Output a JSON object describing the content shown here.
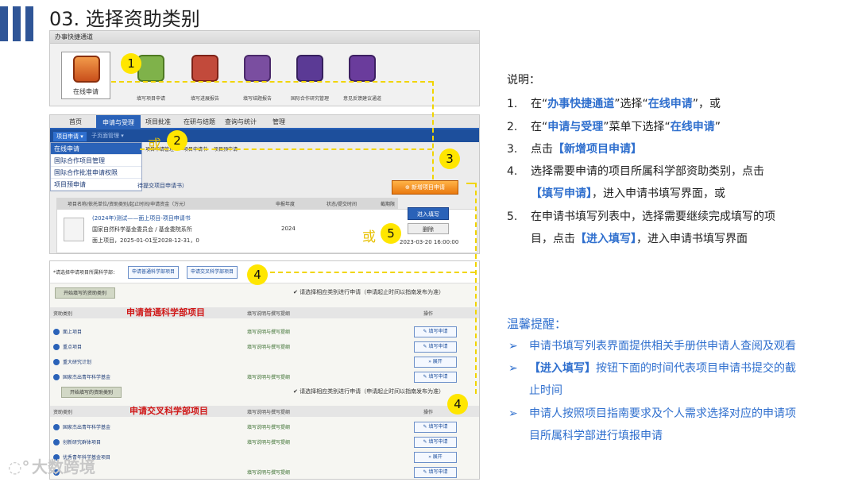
{
  "slide": {
    "title": "03. 选择资助类别"
  },
  "panel1": {
    "header": "办事快捷通道",
    "online": "在线申请",
    "icons": [
      {
        "label": "填写项目申请",
        "color": "#7fb24a"
      },
      {
        "label": "填写进展报告",
        "color": "#c24a3b"
      },
      {
        "label": "填写结题报告",
        "color": "#7a4ea0"
      },
      {
        "label": "国际合作研究管理",
        "color": "#5b3a95"
      },
      {
        "label": "意见反馈建议通道",
        "color": "#6a3c9c"
      }
    ]
  },
  "panel2": {
    "tabs": [
      "首页",
      "申请与受理",
      "项目批准",
      "在研与结题",
      "查询与统计",
      "管理"
    ],
    "sub": [
      "项目申请 ▾",
      "子页面管理 ▾"
    ],
    "menu": [
      "在线申请",
      "国际合作项目管理",
      "国际合作批准申请权限",
      "项目预申请"
    ],
    "crumb1": "项目申请管理",
    "crumb2": "项目申请书",
    "crumb3": "项目预申请",
    "section": "待提交项目申请书）",
    "new_button": "⊕ 新增项目申请",
    "columns": [
      "项目名称/依托单位/资助类别/起止时间/申请资金（万元）",
      "申报年度",
      "状态/提交时间",
      "截期限",
      "提交截止时间"
    ],
    "row": {
      "title": "(2024年)测试——面上项目-项目申请书",
      "org": "国家自然科学基金委员会 / 基金委院系所",
      "type": "面上项目，2025-01-01至2028-12-31，0",
      "year": "2024",
      "fill": "进入填写",
      "delete": "删除",
      "deadline": "2023-03-20 16:00:00"
    }
  },
  "panel3": {
    "choose_label": "*请选择申请项目所属科学部：",
    "btn_general": "申请普通科学部项目",
    "btn_cross": "申请交叉科学部项目",
    "tab1": "开始填写的资助类别",
    "hint1": "✔ 请选择相应类别进行申请（申请起止时间以指南发布为准）",
    "head_cols": [
      "资助类别",
      "填写说明与撰写提纲",
      "操作"
    ],
    "big1": "申请普通科学部项目",
    "rows1": [
      {
        "name": "面上项目",
        "link": "填写说明与撰写提纲",
        "btn": "✎ 填写申请"
      },
      {
        "name": "重点项目",
        "link": "填写说明与撰写提纲",
        "btn": "✎ 填写申请"
      },
      {
        "name": "重大研究计划",
        "link": "",
        "btn": "» 展开"
      },
      {
        "name": "国家杰出青年科学基金",
        "link": "填写说明与撰写提纲",
        "btn": "✎ 填写申请"
      }
    ],
    "tab2": "开始填写的资助类别",
    "hint2": "✔ 请选择相应类别进行申请（申请起止时间以指南发布为准）",
    "big2": "申请交叉科学部项目",
    "rows2": [
      {
        "name": "国家杰出青年科学基金",
        "link": "填写说明与撰写提纲",
        "btn": "✎ 填写申请"
      },
      {
        "name": "创新研究群体项目",
        "link": "填写说明与撰写提纲",
        "btn": "✎ 填写申请"
      },
      {
        "name": "优秀青年科学基金项目",
        "link": "",
        "btn": "» 展开"
      },
      {
        "name": "",
        "link": "填写说明与撰写提纲",
        "btn": "✎ 填写申请"
      }
    ]
  },
  "markers": {
    "m1": "1",
    "m2": "2",
    "m3": "3",
    "m4": "4",
    "m5": "5",
    "or": "或"
  },
  "explain": {
    "title": "说明：",
    "s1": {
      "n": "1.",
      "a": "在“",
      "b": "办事快捷通道",
      "c": "”选择“",
      "d": "在线申请",
      "e": "”，或"
    },
    "s2": {
      "n": "2.",
      "a": "在“",
      "b": "申请与受理",
      "c": "”菜单下选择“",
      "d": "在线申请",
      "e": "”"
    },
    "s3": {
      "n": "3.",
      "a": "点击",
      "b": "【新增项目申请】"
    },
    "s4": {
      "n": "4.",
      "a": "选择需要申请的项目所属科学部资助类别，点击",
      "b": "【填写申请】",
      "c": "，进入申请书填写界面，或"
    },
    "s5": {
      "n": "5.",
      "a": "在申请书填写列表中，选择需要继续完成填写的项",
      "b": "目，点击",
      "c": "【进入填写】",
      "d": "，进入申请书填写界面"
    }
  },
  "tips": {
    "title": "温馨提醒：",
    "t1": "申请书填写列表界面提供相关手册供申请人查阅及观看",
    "t2a": "【进入填写】",
    "t2b": "按钮下面的时间代表项目申请书提交的截",
    "t2c": "止时间",
    "t3a": "申请人按照项目指南要求及个人需求选择对应的申请项",
    "t3b": "目所属科学部进行填报申请",
    "arrow": "➢"
  },
  "watermark": "大数跨境"
}
